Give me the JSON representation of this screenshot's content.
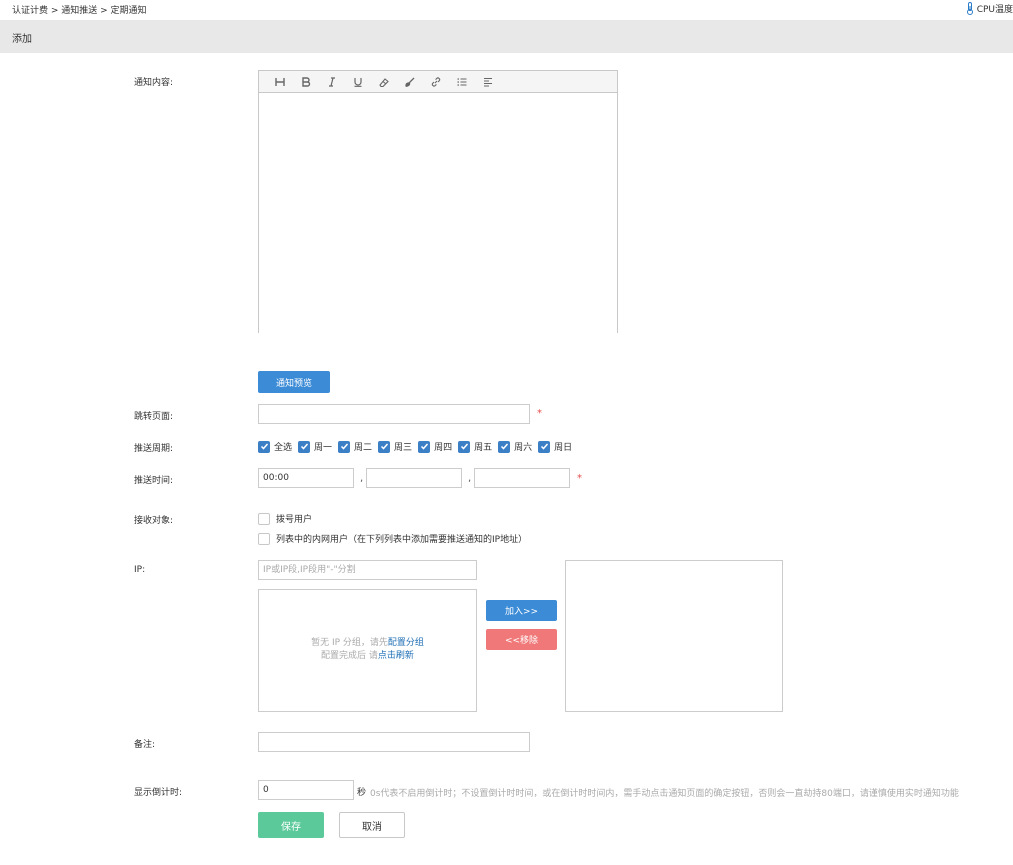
{
  "breadcrumb": "认证计费 > 通知推送 > 定期通知",
  "cpu_label": "CPU温度",
  "page_title": "添加",
  "labels": {
    "content": "通知内容:",
    "jump_page": "跳转页面:",
    "push_cycle": "推送周期:",
    "push_time": "推送时间:",
    "receivers": "接收对象:",
    "ip": "IP:",
    "remark": "备注:",
    "countdown": "显示倒计时:"
  },
  "editor": {
    "toolbar_icons": [
      "heading-icon",
      "bold-icon",
      "italic-icon",
      "underline-icon",
      "eraser-icon",
      "brush-icon",
      "link-icon",
      "list-icon",
      "align-icon"
    ],
    "content": ""
  },
  "preview_button": "通知预览",
  "jump_page_value": "",
  "weekdays": [
    {
      "label": "全选",
      "checked": true
    },
    {
      "label": "周一",
      "checked": true
    },
    {
      "label": "周二",
      "checked": true
    },
    {
      "label": "周三",
      "checked": true
    },
    {
      "label": "周四",
      "checked": true
    },
    {
      "label": "周五",
      "checked": true
    },
    {
      "label": "周六",
      "checked": true
    },
    {
      "label": "周日",
      "checked": true
    }
  ],
  "push_times": [
    "00:00",
    "",
    ""
  ],
  "receivers": [
    {
      "label": "拨号用户",
      "checked": false
    },
    {
      "label": "列表中的内网用户（在下列列表中添加需要推送通知的IP地址）",
      "checked": false
    }
  ],
  "ip_placeholder": "IP或IP段,IP段用\"-\"分割",
  "empty_hint": {
    "line1_prefix": "暂无 IP 分组，请先",
    "line1_link": "配置分组",
    "line2_prefix": "配置完成后 请",
    "line2_link": "点击刷新"
  },
  "add_button": "加入>>",
  "remove_button": "<<移除",
  "remark_value": "",
  "countdown_value": "0",
  "countdown_unit": "秒",
  "countdown_hint": "0s代表不启用倒计时；不设置倒计时时间，或在倒计时时间内，需手动点击通知页面的确定按钮，否则会一直劫持80端口，请谨慎使用实时通知功能",
  "save_button": "保存",
  "cancel_button": "取消",
  "colors": {
    "primary": "#3b8bd6",
    "danger": "#f07878",
    "success": "#5bc99a",
    "required": "#e84c4c"
  }
}
